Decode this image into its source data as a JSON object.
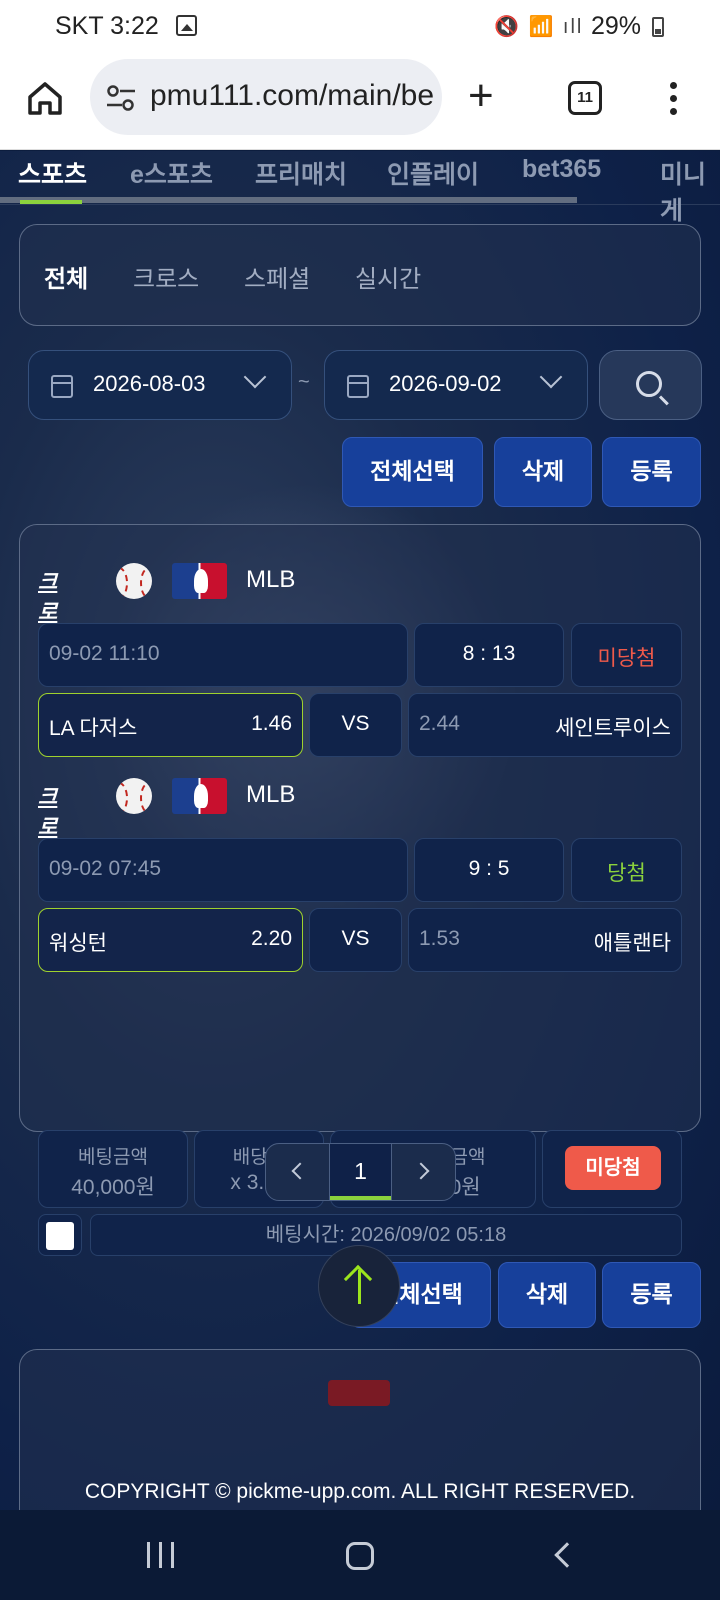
{
  "status": {
    "carrier": "SKT 3:22",
    "sys_icons": "🔇 📶 ıll",
    "battery_pct": "29%"
  },
  "browser": {
    "url": "pmu111.com/main/be",
    "tab_count": "11"
  },
  "sport_tabs": [
    "스포츠",
    "e스포츠",
    "프리매치",
    "인플레이",
    "bet365",
    "미니게"
  ],
  "filter_tabs": [
    "전체",
    "크로스",
    "스페셜",
    "실시간"
  ],
  "date_from": "2026-08-03",
  "date_to": "2026-09-02",
  "date_sep": "~",
  "actions": {
    "select_all": "전체선택",
    "delete": "삭제",
    "register": "등록"
  },
  "bet_card": {
    "matches": [
      {
        "type": "크로스",
        "league": "MLB",
        "time": "09-02 11:10",
        "score": "8 : 13",
        "result": "미당첨",
        "result_color": "#ef5a4a",
        "home": "LA 다저스",
        "home_odds": "1.46",
        "vs": "VS",
        "away_odds": "2.44",
        "away": "세인트루이스"
      },
      {
        "type": "크로스",
        "league": "MLB",
        "time": "09-02 07:45",
        "score": "9 : 5",
        "result": "당첨",
        "result_color": "#8bd23d",
        "home": "워싱턴",
        "home_odds": "2.20",
        "vs": "VS",
        "away_odds": "1.53",
        "away": "애틀랜타"
      }
    ],
    "bet_amount_label": "베팅금액",
    "bet_amount": "40,000원",
    "odds_label": "배당률",
    "odds": "x 3.21",
    "expected_label": "예상적중금액",
    "expected": "128,400원",
    "status": "미당첨",
    "bet_time": "베팅시간: 2026/09/02 05:18"
  },
  "pagination": {
    "current": "1"
  },
  "footer": {
    "copyright": "COPYRIGHT © pickme-upp.com. ALL RIGHT RESERVED."
  }
}
